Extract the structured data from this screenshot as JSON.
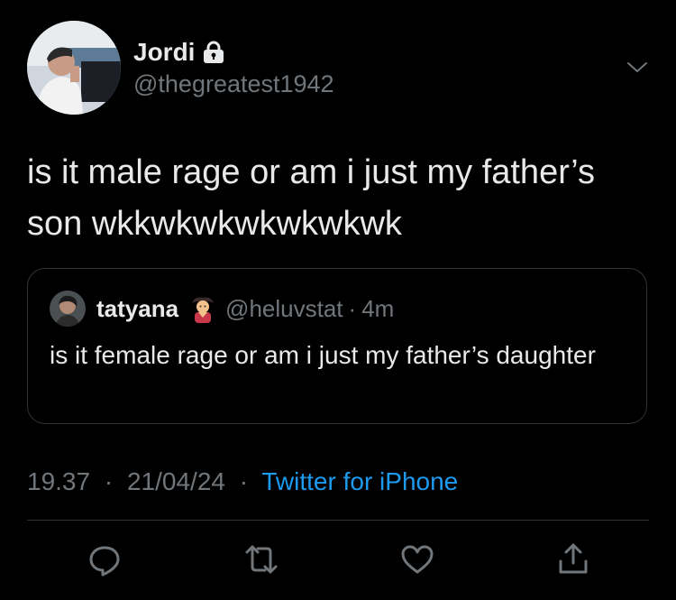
{
  "author": {
    "name": "Jordi",
    "handle": "@thegreatest1942"
  },
  "tweet": {
    "text": "is it male rage or am i just my father’s son wkkwkwkwkwkwkwk"
  },
  "quoted": {
    "name": "tatyana",
    "handle": "@heluvstat",
    "separator": "·",
    "time": "4m",
    "text": "is it female rage or am i just my father’s daughter"
  },
  "meta": {
    "time": "19.37",
    "sep1": "·",
    "date": "21/04/24",
    "sep2": "·",
    "source": "Twitter for iPhone"
  },
  "colors": {
    "background": "#000000",
    "text": "#e7e9ea",
    "secondary": "#71767b",
    "link": "#1d9bf0",
    "border": "#2f3336"
  },
  "icons": [
    "lock-icon",
    "chevron-down-icon",
    "reply-icon",
    "retweet-icon",
    "like-icon",
    "share-icon",
    "genie-emoji-icon"
  ]
}
